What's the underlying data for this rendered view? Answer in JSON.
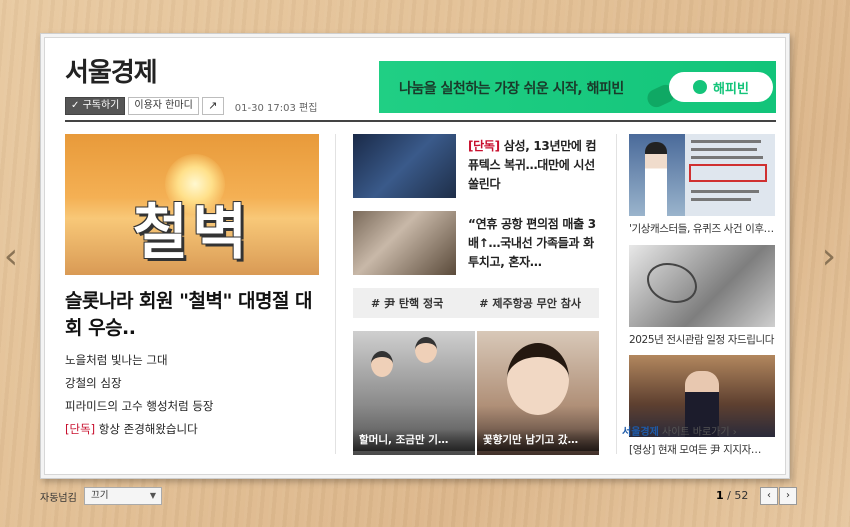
{
  "newspaper": {
    "brand": "서울경제",
    "subscribe_label": "구독하기",
    "comment_label": "이용자 한마디",
    "edit_time": "01-30 17:03 편집"
  },
  "banner": {
    "text": "나눔을 실천하는 가장 쉬운 시작, 해피빈",
    "badge": "해피빈"
  },
  "main_story": {
    "image_text": "철벽",
    "headline": "슬롯나라 회원 \"철벽\" 대명절 대회 우승..",
    "sub_items": [
      {
        "tag": "",
        "text": "노을처럼 빛나는 그대"
      },
      {
        "tag": "",
        "text": "강철의 심장"
      },
      {
        "tag": "",
        "text": "피라미드의 고수 행성처럼 등장"
      },
      {
        "tag": "[단독]",
        "text": " 항상 존경해왔습니다"
      }
    ]
  },
  "mid_stories": [
    {
      "tag": "[단독]",
      "text": " 삼성, 13년만에 컴퓨텍스 복귀…대만에 시선 쏠린다"
    },
    {
      "tag": "",
      "text": "“연휴 공항 편의점 매출 3배↑…국내선 가족들과 화투치고, 혼자…"
    }
  ],
  "topic_tags": [
    "# 尹 탄핵 정국",
    "# 제주항공 무안 참사"
  ],
  "photo_captions": [
    "할머니, 조금만 기…",
    "꽃향기만 남기고 갔…"
  ],
  "side_stories": [
    {
      "caption": "'기상캐스터들, 유퀴즈 사건 이후…"
    },
    {
      "caption": "2025년 전시관람 일정 자드립니다"
    },
    {
      "caption": "[영상] 현재 모여든 尹 지지자…"
    }
  ],
  "site_link": {
    "brand": "서울경제",
    "text": " 사이트 바로가기 ›"
  },
  "footer": {
    "auto_label": "자동넘김",
    "auto_value": "끄기",
    "current_page": "1",
    "total_pages": " / 52",
    "prev_label": "‹",
    "next_label": "›"
  },
  "nav": {
    "left_arrow": "‹",
    "right_arrow": "›"
  }
}
